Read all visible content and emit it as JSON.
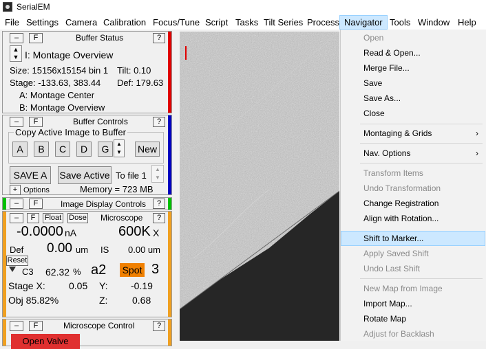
{
  "app": {
    "title": "SerialEM"
  },
  "menubar": {
    "items": [
      "File",
      "Settings",
      "Camera",
      "Calibration",
      "Focus/Tune",
      "Script",
      "Tasks",
      "Tilt Series",
      "Process",
      "Navigator",
      "Tools",
      "Window",
      "Help"
    ]
  },
  "buffer_status": {
    "minus": "–",
    "f": "F",
    "title": "Buffer Status",
    "help": "?",
    "buffer_label": "I: Montage Overview",
    "size": "Size: 15156x15154  bin 1",
    "tilt": "Tilt: 0.10",
    "stage": "Stage: -133.63, 383.44",
    "def": "Def: 179.63",
    "a": "A: Montage Center",
    "b": "B: Montage Overview",
    "bar_color": "#e00000"
  },
  "buffer_controls": {
    "minus": "–",
    "f": "F",
    "title": "Buffer Controls",
    "help": "?",
    "group": "Copy Active Image to Buffer",
    "buttons": [
      "A",
      "B",
      "C",
      "D",
      "G"
    ],
    "new": "New",
    "save_a": "SAVE A",
    "save_active": "Save Active",
    "to_file": "To file 1",
    "plus": "+",
    "options": "Options",
    "memory": "Memory = 723 MB",
    "bar_color": "#0000c0"
  },
  "image_display": {
    "minus": "–",
    "f": "F",
    "title": "Image Display Controls",
    "help": "?",
    "bar_color": "#00c000"
  },
  "microscope": {
    "minus": "–",
    "f": "F",
    "float": "Float",
    "dose": "Dose",
    "label": "Microscope",
    "help": "?",
    "current": "-0.0000",
    "current_unit": "nA",
    "mag": "600K",
    "mag_unit": "X",
    "def_label": "Def",
    "def_value": "0.00",
    "def_unit": "um",
    "is_label": "IS",
    "is_value": "0.00 um",
    "reset": "Reset",
    "c3_label": "C3",
    "c3_value": "62.32",
    "c3_unit": "%",
    "aperture": "a2",
    "spot_label": "Spot",
    "spot_value": "3",
    "stage_x_label": "Stage X:",
    "stage_x": "0.05",
    "y_label": "Y:",
    "y": "-0.19",
    "obj": "Obj  85.82%",
    "z_label": "Z:",
    "z": "0.68",
    "bar_color": "#f0a020",
    "spot_color": "#f08000"
  },
  "microscope_control": {
    "minus": "–",
    "f": "F",
    "title": "Microscope Control",
    "help": "?",
    "open_valve": "Open Valve",
    "bar_color": "#f0a020",
    "valve_color": "#e03030"
  },
  "navigator_menu": {
    "items": [
      {
        "label": "Open",
        "disabled": true
      },
      {
        "label": "Read & Open...",
        "disabled": false
      },
      {
        "label": "Merge File...",
        "disabled": false
      },
      {
        "label": "Save",
        "disabled": false
      },
      {
        "label": "Save As...",
        "disabled": false
      },
      {
        "label": "Close",
        "disabled": false
      },
      {
        "label": "Montaging & Grids",
        "disabled": false,
        "submenu": true
      },
      {
        "label": "Nav. Options",
        "disabled": false,
        "submenu": true
      },
      {
        "label": "Transform Items",
        "disabled": true
      },
      {
        "label": "Undo Transformation",
        "disabled": true
      },
      {
        "label": "Change Registration",
        "disabled": false
      },
      {
        "label": "Align with Rotation...",
        "disabled": false
      },
      {
        "label": "Shift to Marker...",
        "disabled": false,
        "highlighted": true
      },
      {
        "label": "Apply Saved Shift",
        "disabled": true
      },
      {
        "label": "Undo Last Shift",
        "disabled": true
      },
      {
        "label": "New Map from Image",
        "disabled": true
      },
      {
        "label": "Import Map...",
        "disabled": false
      },
      {
        "label": "Rotate Map",
        "disabled": false
      },
      {
        "label": "Adjust for Backlash",
        "disabled": true
      }
    ],
    "submenu_arrow": "›"
  }
}
